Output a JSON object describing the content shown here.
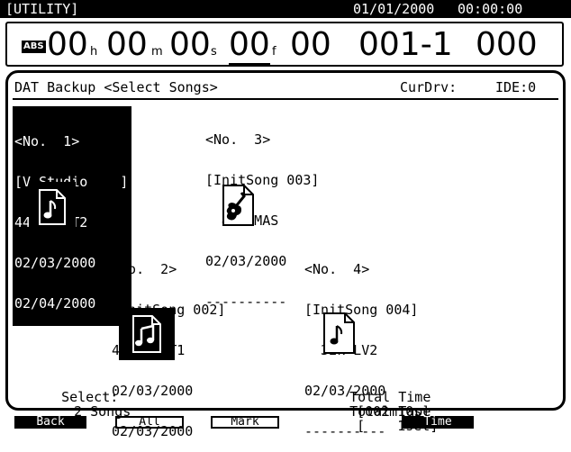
{
  "topbar": {
    "title": "[UTILITY]",
    "date": "01/01/2000",
    "time": "00:00:00"
  },
  "timecode": {
    "badge": "ABS",
    "hours": "00",
    "h_unit": "h",
    "minutes": "00",
    "m_unit": "m",
    "seconds": "00",
    "s_unit": "s",
    "frames": "00",
    "f_unit": "f",
    "subframes": "00",
    "measure_beat": "001-1",
    "tick": "000"
  },
  "header": {
    "title": "DAT Backup <Select Songs>",
    "cur_drv_label": "CurDrv:",
    "cur_drv_value": "IDE:0"
  },
  "songs": [
    {
      "no": "<No.  1>",
      "name": "[V-Studio    ]",
      "rate": "44.1k MT2",
      "date1": "02/03/2000",
      "date2": "02/04/2000",
      "selected": true,
      "icon": "music-note-icon"
    },
    {
      "no": "<No.  2>",
      "name": "[InitSong 002]",
      "rate": "44.1k MT1",
      "date1": "02/03/2000",
      "date2": "02/03/2000",
      "selected": false,
      "icon": "music-notes-icon"
    },
    {
      "no": "<No.  3>",
      "name": "[InitSong 003]",
      "rate": "  48k MAS",
      "date1": "02/03/2000",
      "date2": "----------",
      "selected": false,
      "icon": "guitar-icon"
    },
    {
      "no": "<No.  4>",
      "name": "[InitSong 004]",
      "rate": "  32k LV2",
      "date1": "02/03/2000",
      "date2": "----------",
      "selected": false,
      "icon": "music-note-icon"
    }
  ],
  "footer": {
    "select_label": "Select:",
    "select_value": "2 Songs",
    "total_time_label": "Total Time",
    "total_time_value": "[002m10s]",
    "total_tape_label": "Total Tape",
    "total_tape_value": "[    1set]"
  },
  "function_keys": [
    "Back",
    "All",
    "Mark",
    "",
    "Time"
  ]
}
